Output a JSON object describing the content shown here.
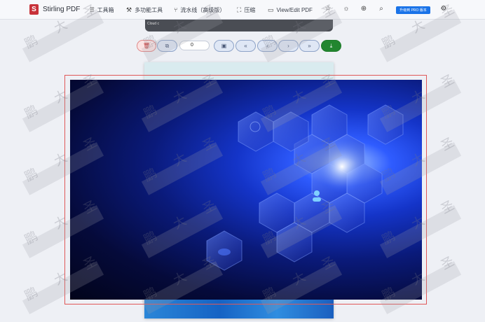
{
  "app": {
    "brand": "Stirling PDF"
  },
  "nav": {
    "tools": "工具箱",
    "multitool": "多功能工具",
    "pipeline": "流水线（高级版）",
    "compress": "压缩",
    "view_edit": "View/Edit PDF",
    "pro": "升级到 PRO 版本"
  },
  "prev_page": {
    "caption": "Cloud c"
  },
  "toolbar": {
    "page_number": "0"
  },
  "watermark": {
    "chars": [
      "鹏",
      "大",
      "圣"
    ]
  },
  "colors": {
    "accent": "#1a73e8",
    "danger": "#c43d3d",
    "download": "#22862f",
    "selection": "#e05858"
  }
}
